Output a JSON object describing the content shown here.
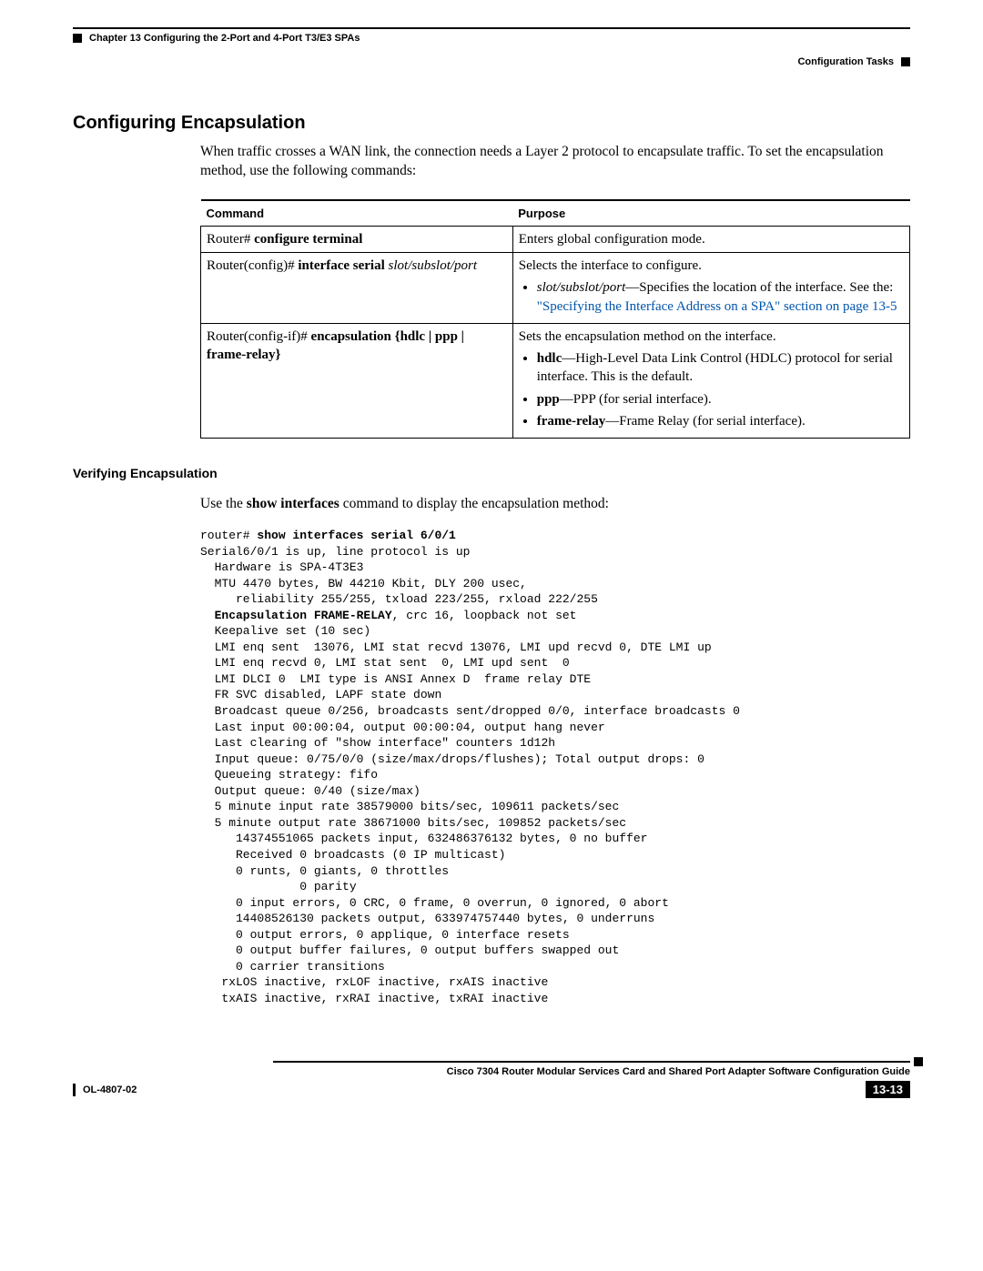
{
  "header": {
    "chapter": "Chapter 13    Configuring the 2-Port and 4-Port T3/E3 SPAs",
    "section_right": "Configuration Tasks"
  },
  "section_title": "Configuring Encapsulation",
  "intro": "When traffic crosses a WAN link, the connection needs a Layer 2 protocol to encapsulate traffic. To set the encapsulation method, use the following commands:",
  "table": {
    "headers": {
      "c1": "Command",
      "c2": "Purpose"
    },
    "rows": [
      {
        "cmd_prefix": "Router# ",
        "cmd_bold": "configure terminal",
        "purpose_text": "Enters global configuration mode."
      },
      {
        "cmd_prefix": "Router(config)# ",
        "cmd_bold": "interface serial",
        "cmd_italic": " slot/subslot/port",
        "purpose_text": "Selects the interface to configure.",
        "bullets": [
          {
            "italic_lead": "slot/subslot/port",
            "text": "—Specifies the location of the interface. See the: ",
            "link": "\"Specifying the Interface Address on a SPA\" section on page 13-5"
          }
        ]
      },
      {
        "cmd_prefix": "Router(config-if)# ",
        "cmd_bold": "encapsulation",
        "cmd_tail_bold": " {hdlc | ppp | frame-relay}",
        "purpose_text": "Sets the encapsulation method on the interface.",
        "bullets": [
          {
            "bold_lead": "hdlc",
            "text": "—High-Level Data Link Control (HDLC) protocol for serial interface. This is the default."
          },
          {
            "bold_lead": "ppp",
            "text": "—PPP (for serial interface)."
          },
          {
            "bold_lead": "frame-relay",
            "text": "—Frame Relay (for serial interface)."
          }
        ]
      }
    ]
  },
  "subheading": "Verifying Encapsulation",
  "verify_text_pre": "Use the ",
  "verify_text_bold": "show interfaces",
  "verify_text_post": " command to display the encapsulation method:",
  "cli": {
    "prompt": "router# ",
    "cmd": "show interfaces serial 6/0/1",
    "lines_before": [
      "Serial6/0/1 is up, line protocol is up",
      "  Hardware is SPA-4T3E3",
      "  MTU 4470 bytes, BW 44210 Kbit, DLY 200 usec,",
      "     reliability 255/255, txload 223/255, rxload 222/255"
    ],
    "encap_bold": "  Encapsulation FRAME-RELAY",
    "encap_rest": ", crc 16, loopback not set",
    "lines_after": [
      "  Keepalive set (10 sec)",
      "  LMI enq sent  13076, LMI stat recvd 13076, LMI upd recvd 0, DTE LMI up",
      "  LMI enq recvd 0, LMI stat sent  0, LMI upd sent  0",
      "  LMI DLCI 0  LMI type is ANSI Annex D  frame relay DTE",
      "  FR SVC disabled, LAPF state down",
      "  Broadcast queue 0/256, broadcasts sent/dropped 0/0, interface broadcasts 0",
      "  Last input 00:00:04, output 00:00:04, output hang never",
      "  Last clearing of \"show interface\" counters 1d12h",
      "  Input queue: 0/75/0/0 (size/max/drops/flushes); Total output drops: 0",
      "  Queueing strategy: fifo",
      "  Output queue: 0/40 (size/max)",
      "  5 minute input rate 38579000 bits/sec, 109611 packets/sec",
      "  5 minute output rate 38671000 bits/sec, 109852 packets/sec",
      "     14374551065 packets input, 632486376132 bytes, 0 no buffer",
      "     Received 0 broadcasts (0 IP multicast)",
      "     0 runts, 0 giants, 0 throttles",
      "              0 parity",
      "     0 input errors, 0 CRC, 0 frame, 0 overrun, 0 ignored, 0 abort",
      "     14408526130 packets output, 633974757440 bytes, 0 underruns",
      "     0 output errors, 0 applique, 0 interface resets",
      "     0 output buffer failures, 0 output buffers swapped out",
      "     0 carrier transitions",
      "   rxLOS inactive, rxLOF inactive, rxAIS inactive",
      "   txAIS inactive, rxRAI inactive, txRAI inactive"
    ]
  },
  "footer": {
    "book_title": "Cisco 7304 Router Modular Services Card and Shared Port Adapter Software Configuration Guide",
    "doc_id": "OL-4807-02",
    "page_no": "13-13"
  }
}
